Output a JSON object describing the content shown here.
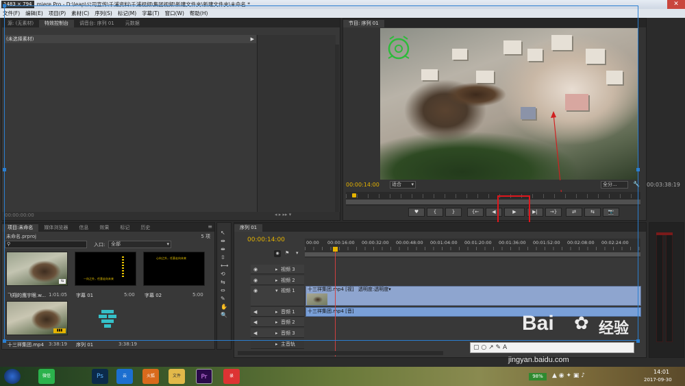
{
  "window": {
    "size_badge": "1483 × 794",
    "title": "miere Pro - D:\\leap\\公司宣传\\千浦资料\\千浦视频\\集团视频\\新建文件夹\\新建文件夹\\未命名 *",
    "close_glyph": "✕"
  },
  "menu": [
    "文件(F)",
    "编辑(E)",
    "项目(P)",
    "素材(C)",
    "序列(S)",
    "标记(M)",
    "字幕(T)",
    "窗口(W)",
    "帮助(H)"
  ],
  "source_panel": {
    "tabs": [
      "源: (无素材)",
      "特效控制台",
      "调音台: 序列 01",
      "元数据"
    ],
    "active_tab": 1,
    "header": "(未选择素材)",
    "timecode": "00:00:00:00"
  },
  "program_monitor": {
    "tab": "节目: 序列 01",
    "timecode_left": "00:00:14:00",
    "fit_select": "适合",
    "quality_select": "全分...",
    "timecode_right": "00:03:38:19",
    "controls": [
      "♥",
      "{",
      "}",
      "{←",
      "◀",
      "▶",
      "▶|",
      "→}",
      "⇄",
      "⇆",
      "📷"
    ],
    "play_button_icon": "play-icon",
    "highlight_color": "#e0161c",
    "arrow_color": "#d02020"
  },
  "project_panel": {
    "tabs": [
      "项目:未命名",
      "媒体浏览器",
      "信息",
      "效果",
      "标记",
      "历史"
    ],
    "project_file": "未命名.prproj",
    "item_count": "5 项",
    "search_placeholder": "",
    "in_point_label": "入口:",
    "in_point_value": "全部",
    "items": [
      {
        "name": "飞翔的鹰宇眼.w...",
        "duration": "1:01:05"
      },
      {
        "name": "字幕 01",
        "duration": "5:00",
        "caption_lines": [
          "一向之外，任意走向未来"
        ]
      },
      {
        "name": "字幕 02",
        "duration": "5:00",
        "caption_lines": [
          "心向之外，任意走向未来"
        ]
      },
      {
        "name": "十三祥集团.mp4",
        "duration": "3:38:19"
      },
      {
        "name": "序列 01",
        "duration": "3:38:19"
      }
    ]
  },
  "timeline": {
    "tab": "序列 01",
    "timecode": "00:00:14:00",
    "ruler": [
      "00:00",
      "00:00:16:00",
      "00:00:32:00",
      "00:00:48:00",
      "00:01:04:00",
      "00:01:20:00",
      "00:01:36:00",
      "00:01:52:00",
      "00:02:08:00",
      "00:02:24:00"
    ],
    "tracks": [
      {
        "name": "视频 3"
      },
      {
        "name": "视频 2"
      },
      {
        "name": "视频 1"
      },
      {
        "name": "音频 1"
      },
      {
        "name": "音频 2"
      },
      {
        "name": "音频 3"
      },
      {
        "name": "主音轨"
      }
    ],
    "video_clip_label": "十三祥集团.mp4 [视]",
    "opacity_label": "透明度:透明度▾",
    "audio_clip_label": "十三祥集团.mp4 [音]"
  },
  "tools": [
    "↖",
    "⇹",
    "⇼",
    "⇳",
    "⟷",
    "⟲",
    "⇆",
    "⇔",
    "✎",
    "✋",
    "🔍"
  ],
  "taskbar": {
    "apps": [
      "微信",
      "Ps",
      "云",
      "火狐",
      "文件",
      "Pr",
      "录"
    ],
    "battery": "98%",
    "time": "14:01",
    "date": "2017-09-30"
  },
  "watermark": {
    "brand": "Bai",
    "brand_cn": "经验",
    "url": "jingyan.baidu.com"
  }
}
